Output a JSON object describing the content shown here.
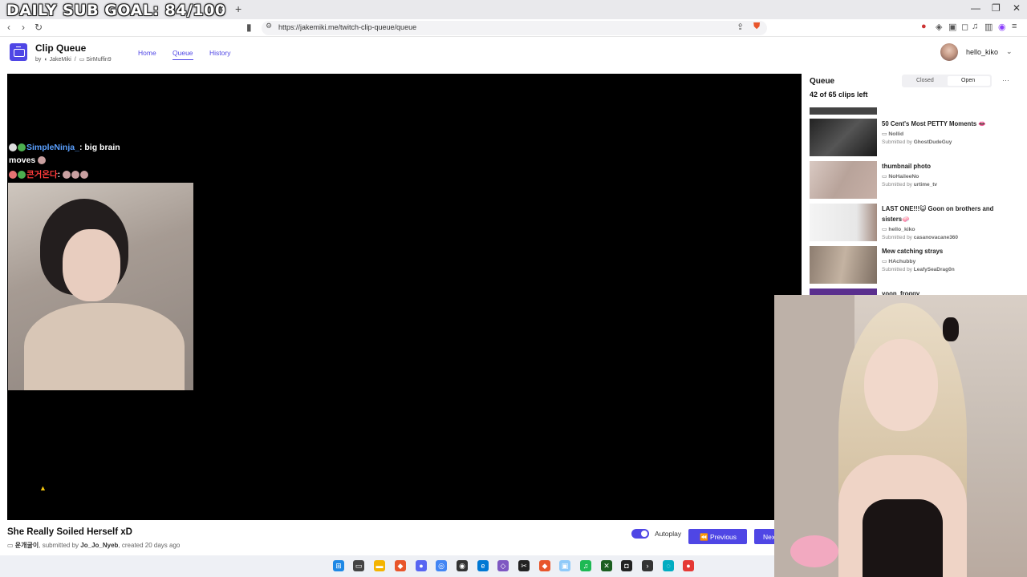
{
  "overlay": {
    "goal_text": "DAILY SUB GOAL: 84/100"
  },
  "browser": {
    "url": "https://jakemiki.me/twitch-clip-queue/queue",
    "tab_close": "×",
    "tab_new": "+"
  },
  "app": {
    "title": "Clip Queue",
    "by": "by",
    "author1": "JakeMiki",
    "separator": "/",
    "author2": "SirMuffin9",
    "nav": [
      "Home",
      "Queue",
      "History"
    ],
    "user_name": "hello_kiko"
  },
  "chat": [
    {
      "user": "SimpleNinja_",
      "msg": ": big brain"
    },
    {
      "msg": "moves"
    },
    {
      "user": "콘거온다",
      "msg": ":"
    }
  ],
  "clip": {
    "title": "She Really Soiled Herself xD",
    "channel": "운개굴이",
    "submitted_prefix": ", submitted by",
    "submitter": "Jo_Jo_Nyeb",
    "created": ", created 20 days ago"
  },
  "controls": {
    "autoplay_label": "Autoplay",
    "autoplay_on": true,
    "prev_label": "Previous",
    "next_label": "Next"
  },
  "queue": {
    "title": "Queue",
    "count": "42 of 65 clips left",
    "closed_label": "Closed",
    "open_label": "Open",
    "more": "···",
    "items": [
      {
        "title": "50 Cent's Most PETTY Moments 👄",
        "channel": "Nollid",
        "submitted_prefix": "Submitted by",
        "submitter": "GhostDudeGuy"
      },
      {
        "title": "thumbnail photo",
        "channel": "NoHaileeNo",
        "submitted_prefix": "Submitted by",
        "submitter": "urtime_tv"
      },
      {
        "title": "LAST ONE!!!😺 Goon on brothers and sisters🧼",
        "channel": "hello_kiko",
        "submitted_prefix": "Submitted by",
        "submitter": "casanovacane360"
      },
      {
        "title": "Mew catching strays",
        "channel": "HAchubby",
        "submitted_prefix": "Submitted by",
        "submitter": "LeafySeaDrag0n"
      },
      {
        "title": "yoon_froggy"
      }
    ]
  },
  "colors": {
    "accent": "#4f46e5",
    "player_bg": "#000000"
  }
}
